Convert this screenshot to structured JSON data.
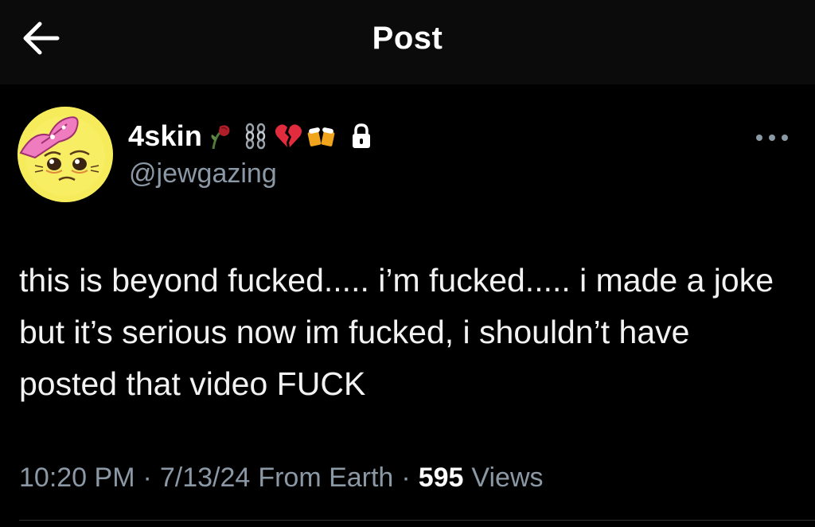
{
  "header": {
    "title": "Post",
    "back_icon": "arrow-left-icon"
  },
  "author": {
    "display_name": "4skin",
    "name_emojis": [
      "wilted-rose-icon",
      "chains-icon",
      "broken-heart-icon",
      "beer-mugs-icon"
    ],
    "protected_icon": "lock-icon",
    "handle": "@jewgazing",
    "avatar": "pleading-face-avatar"
  },
  "more_icon": "more-dots-icon",
  "post": {
    "text": "this is beyond fucked..... i’m fucked..... i made a joke but it’s serious now im fucked, i shouldn’t have posted that video FUCK"
  },
  "meta": {
    "time": "10:20 PM",
    "separator": "·",
    "date": "7/13/24",
    "source": "From Earth",
    "views_count": "595",
    "views_label": "Views"
  },
  "colors": {
    "background": "#000000",
    "header_background": "#0b0b0b",
    "secondary_text": "#8b98a5",
    "primary_text": "#ffffff"
  }
}
